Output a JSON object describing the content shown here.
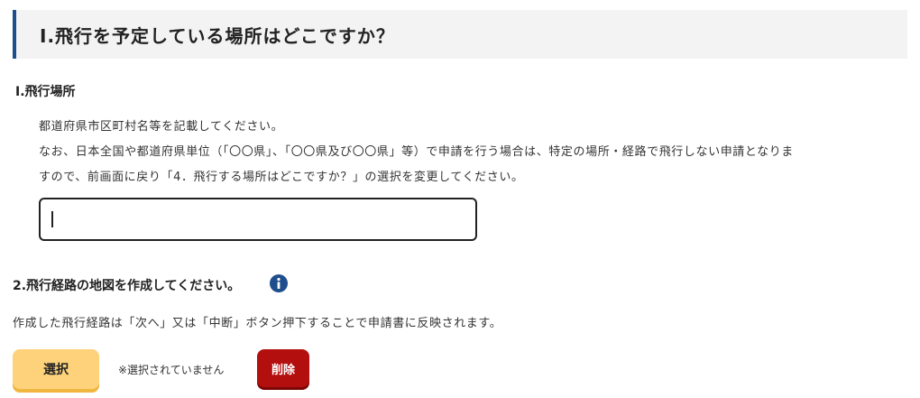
{
  "section": {
    "title": "Ⅰ.飛行を予定している場所はどこですか？"
  },
  "flight_location": {
    "label": "Ⅰ.飛行場所",
    "instruction_1": "都道府県市区町村名等を記載してください。",
    "instruction_2": "なお、日本全国や都道府県単位（「〇〇県」、「〇〇県及び〇〇県」等）で申請を行う場合は、特定の場所・経路で飛行しない申請となりま",
    "instruction_3": "すので、前画面に戻り「4．飛行する場所はどこですか？」の選択を変更してください。",
    "input_value": ""
  },
  "flight_route_map": {
    "label": "2.飛行経路の地図を作成してください。",
    "info_icon": "info-circle-icon",
    "description": "作成した飛行経路は「次へ」又は「中断」ボタン押下することで申請書に反映されます。",
    "select_button_label": "選択",
    "status_text": "※選択されていません",
    "delete_button_label": "削除"
  },
  "colors": {
    "header_accent": "#1f4e8c",
    "header_bg": "#f3f3f3",
    "info_icon": "#1f4e8c",
    "select_button": "#fdd27a",
    "delete_button": "#b40f0f"
  }
}
